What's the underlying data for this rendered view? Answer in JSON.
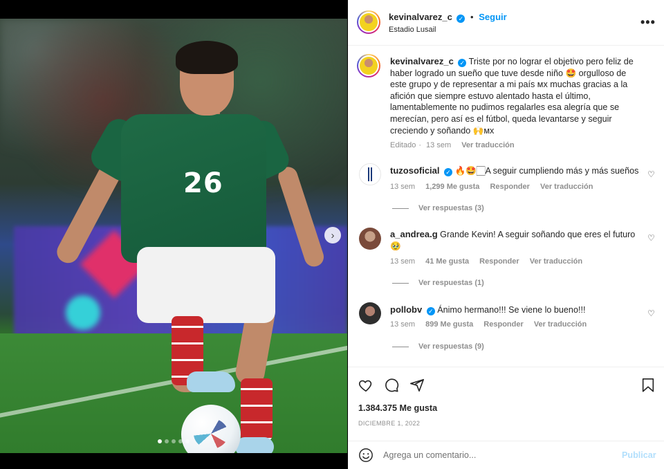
{
  "header": {
    "username": "kevinalvarez_c",
    "separator": "•",
    "follow_label": "Seguir",
    "location": "Estadio Lusail",
    "more_label": "•••"
  },
  "caption": {
    "username": "kevinalvarez_c",
    "text": "Triste por no lograr el objetivo pero feliz de haber logrado un sueño que tuve desde niño 🤩 orgulloso de este grupo y de representar a mi país ᴍx muchas gracias a la afición que siempre estuvo alentado hasta el último, lamentablemente no pudimos regalarles esa alegría que se merecían, pero así es el fútbol, queda levantarse y seguir creciendo y soñando 🙌ᴍx",
    "edited": "Editado",
    "time": "13 sem",
    "translate": "Ver traducción"
  },
  "comments": [
    {
      "username": "tuzosoficial",
      "verified": true,
      "text": "🔥🤩🏻A seguir cumpliendo más y más sueños",
      "time": "13 sem",
      "likes": "1,299 Me gusta",
      "reply": "Responder",
      "translate": "Ver traducción",
      "replies": "Ver respuestas (3)"
    },
    {
      "username": "a_andrea.g",
      "verified": false,
      "text": "Grande Kevin! A seguir soñando que eres el futuro 🥹",
      "time": "13 sem",
      "likes": "41 Me gusta",
      "reply": "Responder",
      "translate": "Ver traducción",
      "replies": "Ver respuestas (1)"
    },
    {
      "username": "pollobv",
      "verified": true,
      "text": "Ánimo hermano!!! Se viene lo bueno!!!",
      "time": "13 sem",
      "likes": "899 Me gusta",
      "reply": "Responder",
      "translate": "Ver traducción",
      "replies": "Ver respuestas (9)"
    }
  ],
  "actions": {
    "likes": "1.384.375 Me gusta",
    "date": "DICIEMBRE 1, 2022"
  },
  "compose": {
    "placeholder": "Agrega un comentario...",
    "publish_label": "Publicar"
  },
  "media": {
    "jersey_number": "26",
    "next_label": "›",
    "carousel_dots": 5,
    "active_dot": 0
  },
  "colors": {
    "accent": "#0095f6",
    "publish_disabled": "#b2dffc",
    "secondary_text": "#8e8e8e"
  }
}
